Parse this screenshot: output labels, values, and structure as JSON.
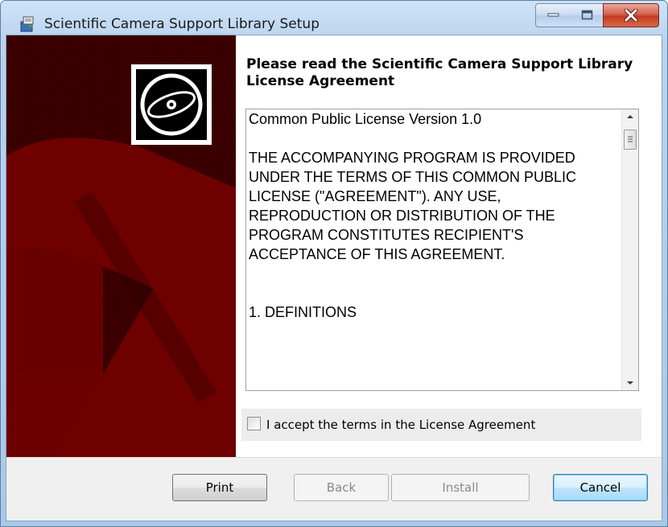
{
  "window": {
    "title": "Scientific Camera Support Library Setup"
  },
  "dialog": {
    "heading": "Please read the Scientific Camera Support Library License Agreement",
    "license_paragraphs": [
      "Common Public License Version 1.0",
      "THE ACCOMPANYING PROGRAM IS PROVIDED UNDER THE TERMS OF THIS COMMON PUBLIC LICENSE (\"AGREEMENT\"). ANY USE, REPRODUCTION OR DISTRIBUTION OF THE PROGRAM CONSTITUTES RECIPIENT'S ACCEPTANCE OF THIS AGREEMENT.",
      "1. DEFINITIONS"
    ],
    "accept_label": "I accept the terms in the License Agreement",
    "accept_checked": false
  },
  "buttons": {
    "print": "Print",
    "back": "Back",
    "install": "Install",
    "cancel": "Cancel"
  },
  "icons": {
    "app": "setup-package-icon",
    "banner": "cd-disc-icon"
  },
  "colors": {
    "banner_dark_red": "#6e0000",
    "banner_black": "#1a0000",
    "default_button": "#3c7fb1",
    "close_button": "#c43a22"
  }
}
